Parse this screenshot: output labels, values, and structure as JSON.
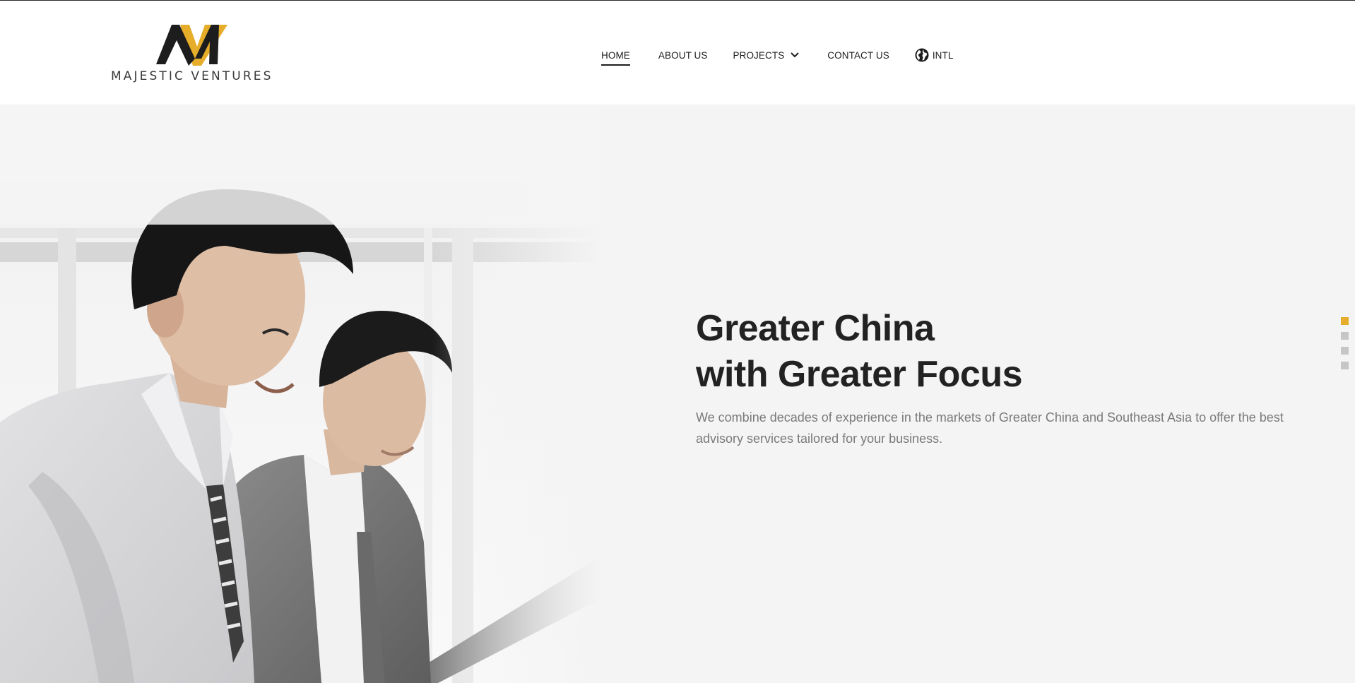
{
  "brand": {
    "name": "MAJESTIC VENTURES",
    "accent_color": "#e5ad29",
    "dark_color": "#1d1d1d"
  },
  "nav": {
    "items": [
      {
        "label": "HOME",
        "active": true
      },
      {
        "label": "ABOUT US"
      },
      {
        "label": "PROJECTS",
        "icon": "chevron-down-icon"
      },
      {
        "label": "CONTACT US"
      },
      {
        "label": "INTL",
        "icon": "globe-icon"
      }
    ]
  },
  "hero": {
    "title_line1": "Greater China",
    "title_line2": "with Greater Focus",
    "description": "We combine decades of experience in the markets of Greater China and Southeast Asia to offer the best advisory services tailored for your business.",
    "slides_total": 4,
    "active_slide": 1
  }
}
